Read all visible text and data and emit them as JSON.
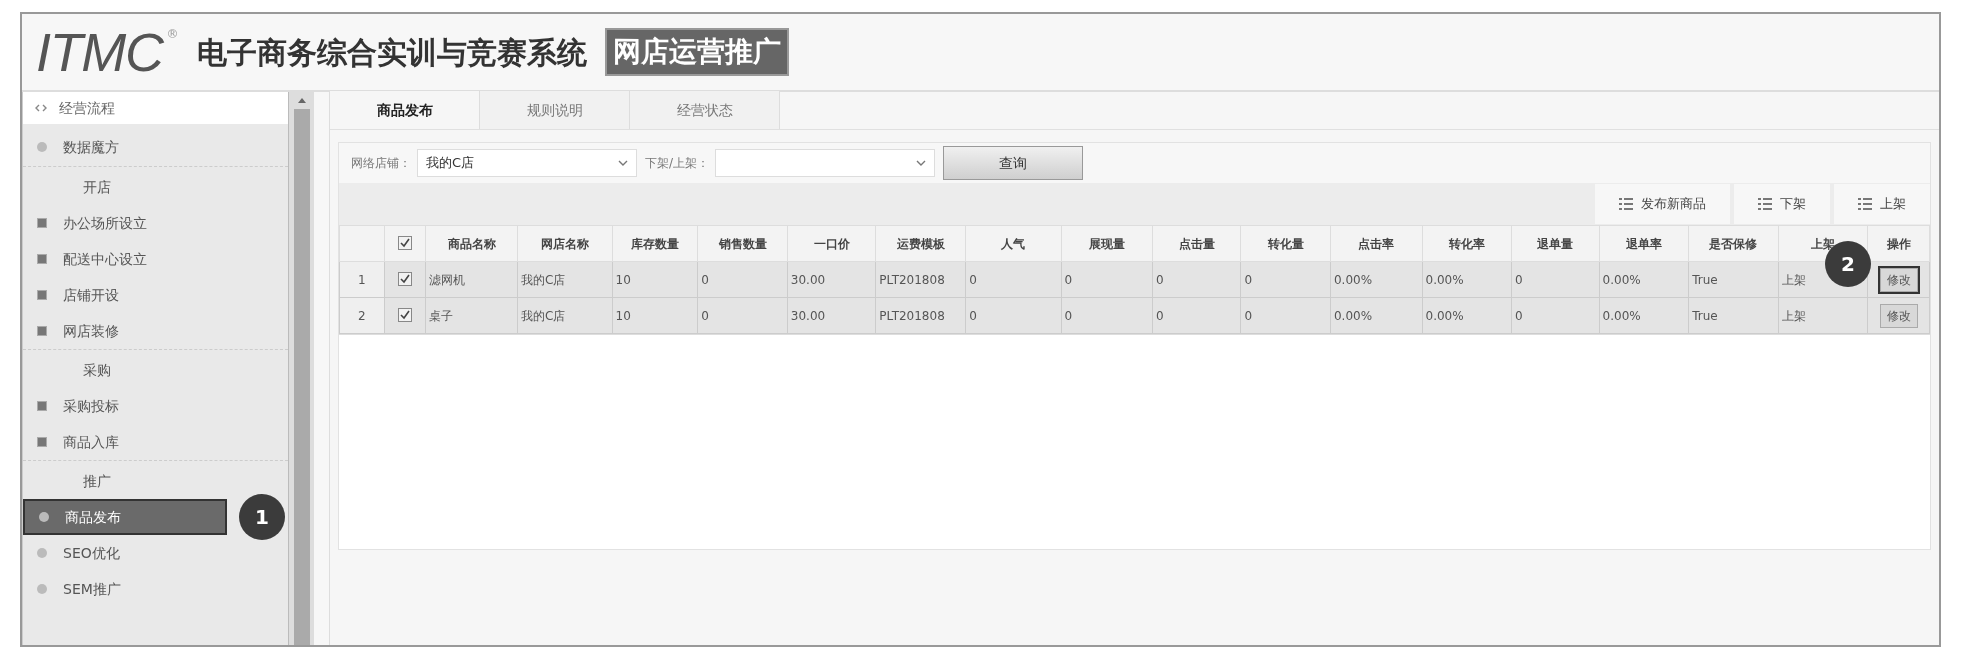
{
  "header": {
    "logo": "ITMC",
    "reg_mark": "®",
    "title": "电子商务综合实训与竞赛系统",
    "module": "网店运营推广"
  },
  "sidebar": {
    "title": "经营流程",
    "items": [
      {
        "label": "数据魔方",
        "kind": "dot",
        "selected": false
      },
      {
        "label": "开店",
        "children": [
          {
            "label": "办公场所设立",
            "kind": "box",
            "selected": false
          },
          {
            "label": "配送中心设立",
            "kind": "box",
            "selected": false
          },
          {
            "label": "店铺开设",
            "kind": "box",
            "selected": false
          },
          {
            "label": "网店装修",
            "kind": "box",
            "selected": false
          }
        ]
      },
      {
        "label": "采购",
        "children": [
          {
            "label": "采购投标",
            "kind": "box",
            "selected": false
          },
          {
            "label": "商品入库",
            "kind": "box",
            "selected": false
          }
        ]
      },
      {
        "label": "推广",
        "children": [
          {
            "label": "商品发布",
            "kind": "dot",
            "selected": true
          },
          {
            "label": "SEO优化",
            "kind": "dot",
            "selected": false
          },
          {
            "label": "SEM推广",
            "kind": "dot",
            "selected": false
          }
        ]
      }
    ]
  },
  "callouts": [
    {
      "text": "1"
    },
    {
      "text": "2"
    }
  ],
  "tabs": [
    {
      "label": "商品发布",
      "selected": true
    },
    {
      "label": "规则说明",
      "selected": false
    },
    {
      "label": "经营状态",
      "selected": false
    }
  ],
  "filters": [
    {
      "label": "网络店铺：",
      "value": "我的C店"
    },
    {
      "label": "下架/上架："
    }
  ],
  "query_button": "查询",
  "toolbar": [
    "发布新商品",
    "下架",
    "上架"
  ],
  "table": {
    "columns": [
      "商品名称",
      "网店名称",
      "库存数量",
      "销售数量",
      "一口价",
      "运费模板",
      "人气",
      "展现量",
      "点击量",
      "转化量",
      "点击率",
      "转化率",
      "退单量",
      "退单率",
      "是否保修",
      "上架",
      "操作"
    ],
    "rows": [
      {
        "index": "1",
        "checked": true,
        "cells": [
          "滤网机",
          "我的C店",
          "10",
          "0",
          "30.00",
          "PLT201808",
          "0",
          "0",
          "0",
          "0",
          "0.00%",
          "0.00%",
          "0",
          "0.00%",
          "True",
          "上架"
        ],
        "action": "修改"
      },
      {
        "index": "2",
        "checked": true,
        "cells": [
          "桌子",
          "我的C店",
          "10",
          "0",
          "30.00",
          "PLT201808",
          "0",
          "0",
          "0",
          "0",
          "0.00%",
          "0.00%",
          "0",
          "0.00%",
          "True",
          "上架"
        ],
        "action": "修改"
      }
    ],
    "all_checked": true
  }
}
